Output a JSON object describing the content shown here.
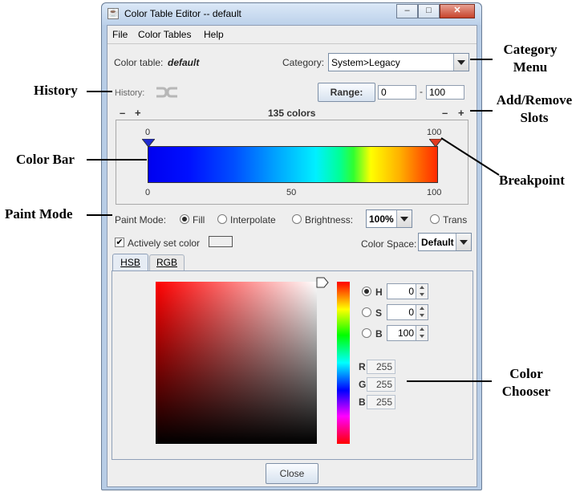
{
  "window": {
    "title": "Color Table Editor -- default",
    "minimize": "–",
    "maximize": "□",
    "close": "✕"
  },
  "menu": [
    "File",
    "Color Tables",
    "Help"
  ],
  "color_table": {
    "label": "Color table:",
    "name": "default"
  },
  "category": {
    "label": "Category:",
    "value": "System>Legacy"
  },
  "history": {
    "label": "History:"
  },
  "range": {
    "button": "Range:",
    "min": "0",
    "separator": "-",
    "max": "100"
  },
  "slots": {
    "minus": "–",
    "plus": "+",
    "count": "135 colors"
  },
  "colorbar": {
    "top_left": "0",
    "top_right": "100",
    "ticks": [
      "0",
      "50",
      "100"
    ],
    "breakpoint_left_color": "#1f2bd1",
    "breakpoint_right_color": "#e3391e"
  },
  "paint_mode": {
    "label": "Paint Mode:",
    "options": [
      "Fill",
      "Interpolate",
      "Brightness:"
    ],
    "selected": "Fill",
    "brightness": "100%",
    "trans": "Trans"
  },
  "active_color": {
    "label": "Actively set color",
    "checked": true
  },
  "color_space": {
    "label": "Color Space:",
    "value": "Default"
  },
  "tabs": [
    "HSB",
    "RGB"
  ],
  "hsb": [
    {
      "label": "H",
      "value": "0",
      "selected": true
    },
    {
      "label": "S",
      "value": "0"
    },
    {
      "label": "B",
      "value": "100"
    }
  ],
  "rgb": [
    {
      "label": "R",
      "value": "255"
    },
    {
      "label": "G",
      "value": "255"
    },
    {
      "label": "B",
      "value": "255"
    }
  ],
  "close_button": "Close",
  "annotations": {
    "category_menu": "Category Menu",
    "history": "History",
    "add_remove_slots": "Add/Remove Slots",
    "color_bar": "Color Bar",
    "breakpoint": "Breakpoint",
    "paint_mode": "Paint Mode",
    "color_chooser": "Color Chooser"
  }
}
